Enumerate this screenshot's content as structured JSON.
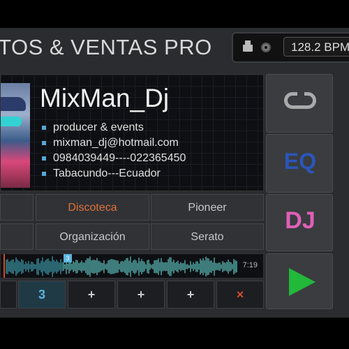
{
  "header": {
    "title": "ITOS & VENTAS PRO",
    "bpm": "128.2 BPM"
  },
  "profile": {
    "name": "MixMan_Dj",
    "info": [
      "producer & events",
      "mixman_dj@hotmail.com",
      "0984039449----022365450",
      "Tabacundo---Ecuador"
    ]
  },
  "tags": {
    "row1": [
      "Discoteca",
      "Pioneer"
    ],
    "row2": [
      "Organización",
      "Serato"
    ]
  },
  "side": {
    "eq_label": "EQ",
    "dj_label": "DJ"
  },
  "waveform": {
    "time": "7:19",
    "cue_marker": "3"
  },
  "cues": [
    "3",
    "+",
    "+",
    "+",
    "×"
  ],
  "colors": {
    "accent_blue": "#5ab4e0",
    "eq_blue": "#2a56b8",
    "dj_pink": "#e060b8",
    "play_green": "#22b83a",
    "active_tag": "#e0703a"
  },
  "icons": [
    "usb-icon",
    "disc-icon",
    "loop-icon",
    "play-icon"
  ]
}
